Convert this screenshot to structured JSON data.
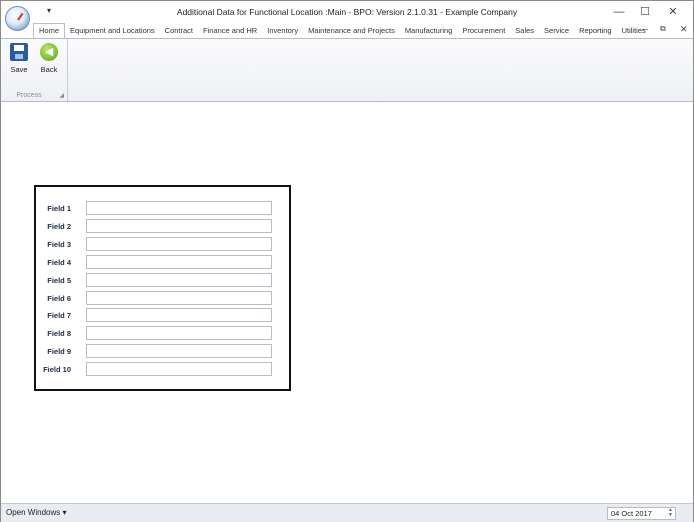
{
  "window": {
    "title": "Additional Data for Functional Location :Main - BPO: Version 2.1.0.31 - Example Company",
    "qat_arrow": "▾",
    "min_glyph": "—",
    "max_glyph": "☐",
    "close_glyph": "✕"
  },
  "ribbon": {
    "tabs": [
      "Home",
      "Equipment and Locations",
      "Contract",
      "Finance and HR",
      "Inventory",
      "Maintenance and Projects",
      "Manufacturing",
      "Procurement",
      "Sales",
      "Service",
      "Reporting",
      "Utilities"
    ],
    "active_tab": "Home",
    "controls": {
      "min": "–",
      "restore": "⧉",
      "close": "✕"
    },
    "groups": {
      "process": {
        "label": "Process",
        "save_label": "Save",
        "back_label": "Back"
      }
    }
  },
  "form": {
    "fields": [
      {
        "label": "Field 1",
        "value": ""
      },
      {
        "label": "Field 2",
        "value": ""
      },
      {
        "label": "Field 3",
        "value": ""
      },
      {
        "label": "Field 4",
        "value": ""
      },
      {
        "label": "Field 5",
        "value": ""
      },
      {
        "label": "Field 6",
        "value": ""
      },
      {
        "label": "Field 7",
        "value": ""
      },
      {
        "label": "Field 8",
        "value": ""
      },
      {
        "label": "Field 9",
        "value": ""
      },
      {
        "label": "Field 10",
        "value": ""
      }
    ]
  },
  "statusbar": {
    "open_windows_label": "Open Windows ▾",
    "date": "04 Oct 2017"
  }
}
